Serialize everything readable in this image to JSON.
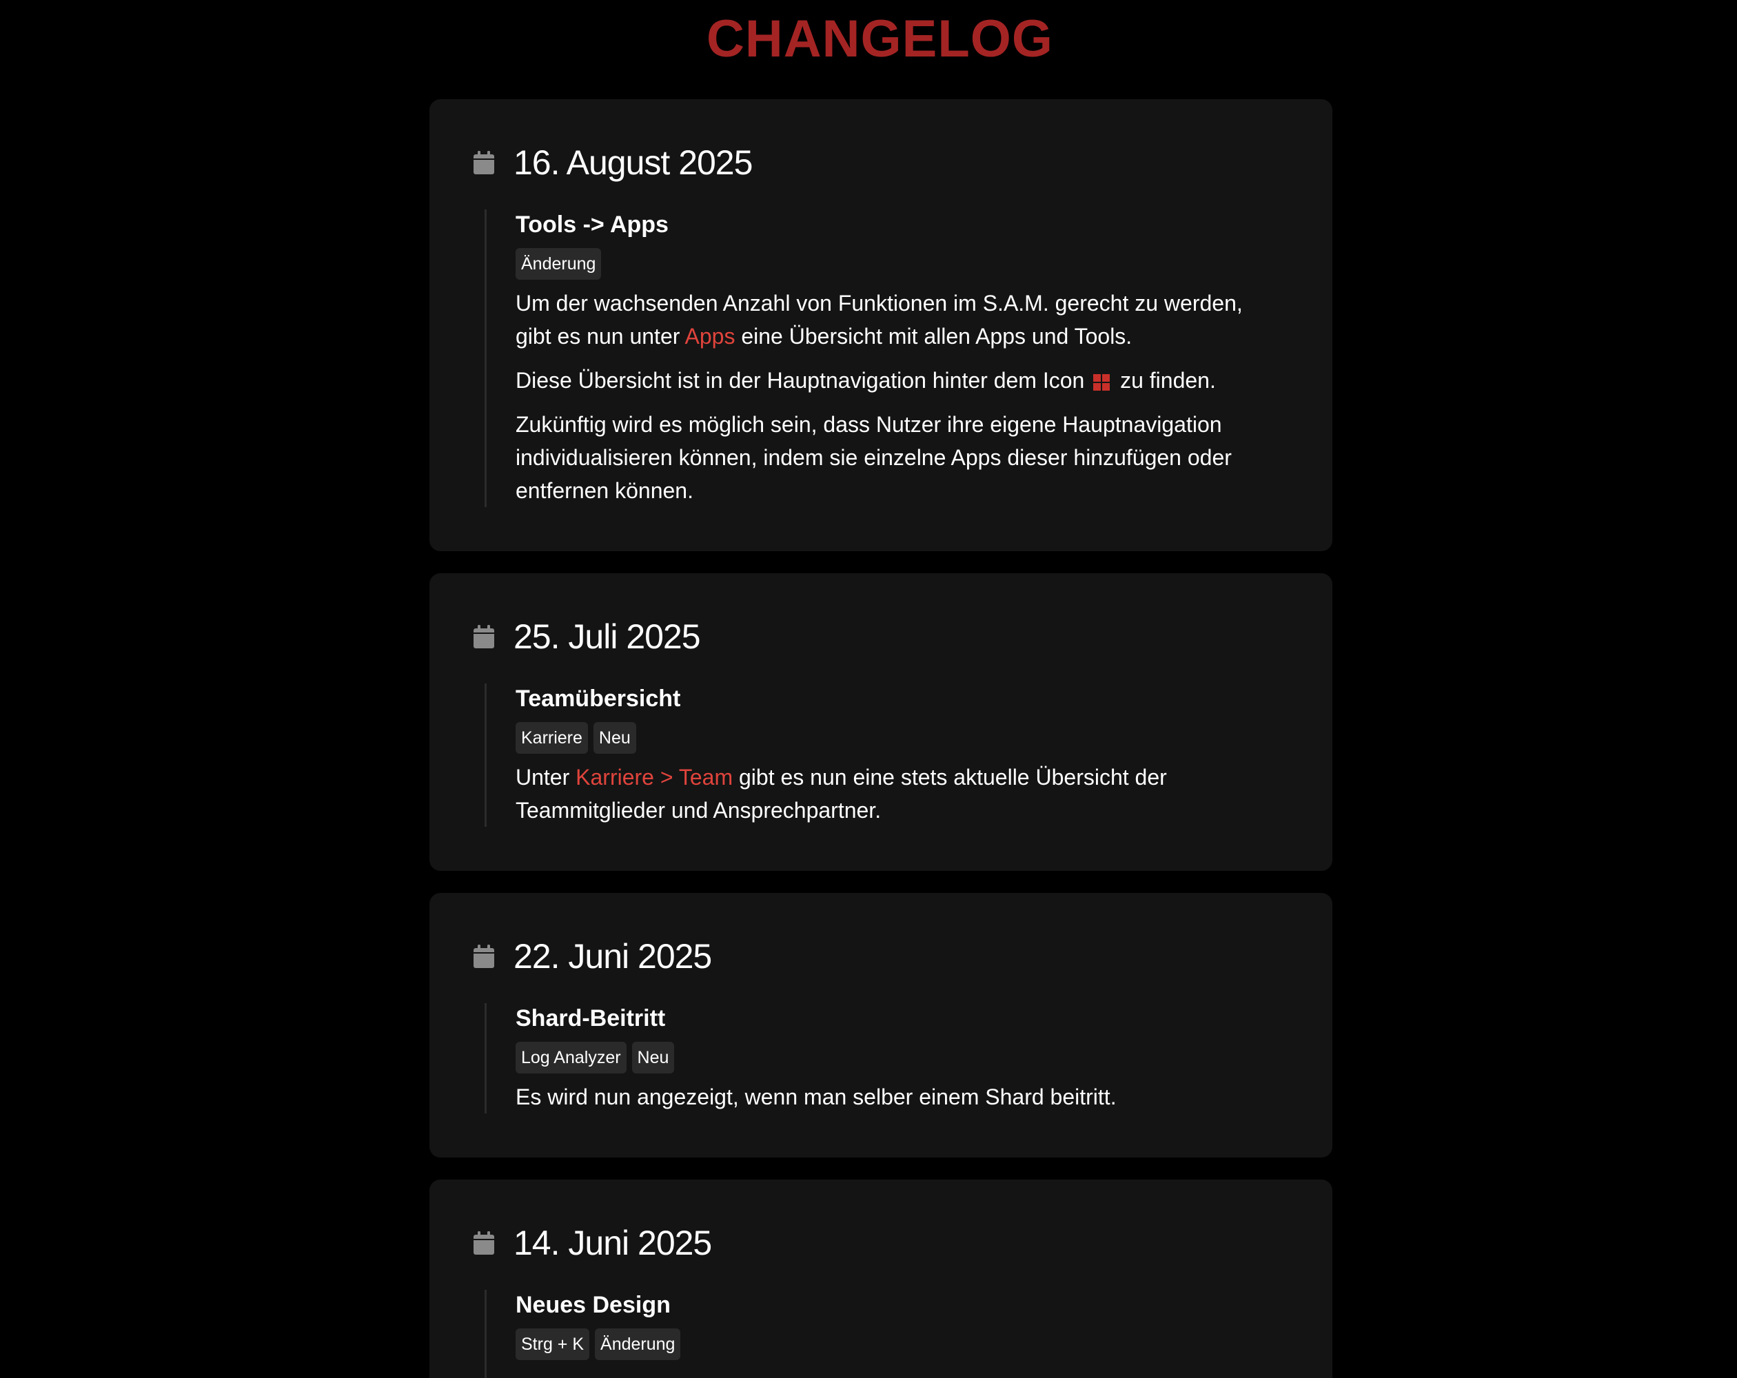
{
  "header": {
    "title": "CHANGELOG"
  },
  "colors": {
    "background": "#000000",
    "card": "#141414",
    "accent_title": "#a42424",
    "link": "#e0443c",
    "tag_background": "#2a2a2a",
    "calendar_icon": "#8a8a8a",
    "timeline_line": "#2c2c2c"
  },
  "entries": [
    {
      "date": "16. August 2025",
      "title": "Tools -> Apps",
      "tags": [
        "Änderung"
      ],
      "paragraphs": [
        {
          "before": "Um der wachsenden Anzahl von Funktionen im S.A.M. gerecht zu werden, gibt es nun unter ",
          "link": "Apps",
          "after": " eine Übersicht mit allen Apps und Tools."
        },
        {
          "before": "Diese Übersicht ist in der Hauptnavigation hinter dem Icon ",
          "icon": "grid-icon",
          "after": " zu finden."
        },
        {
          "text": "Zukünftig wird es möglich sein, dass Nutzer ihre eigene Hauptnavigation individualisieren können, indem sie einzelne Apps dieser hinzufügen oder entfernen können."
        }
      ]
    },
    {
      "date": "25. Juli 2025",
      "title": "Teamübersicht",
      "tags": [
        "Karriere",
        "Neu"
      ],
      "paragraphs": [
        {
          "before": "Unter ",
          "link": "Karriere > Team",
          "after": " gibt es nun eine stets aktuelle Übersicht der Teammitglieder und Ansprechpartner."
        }
      ]
    },
    {
      "date": "22. Juni 2025",
      "title": "Shard-Beitritt",
      "tags": [
        "Log Analyzer",
        "Neu"
      ],
      "paragraphs": [
        {
          "text": "Es wird nun angezeigt, wenn man selber einem Shard beitritt."
        }
      ]
    },
    {
      "date": "14. Juni 2025",
      "title": "Neues Design",
      "tags": [
        "Strg + K",
        "Änderung"
      ],
      "paragraphs": []
    }
  ]
}
